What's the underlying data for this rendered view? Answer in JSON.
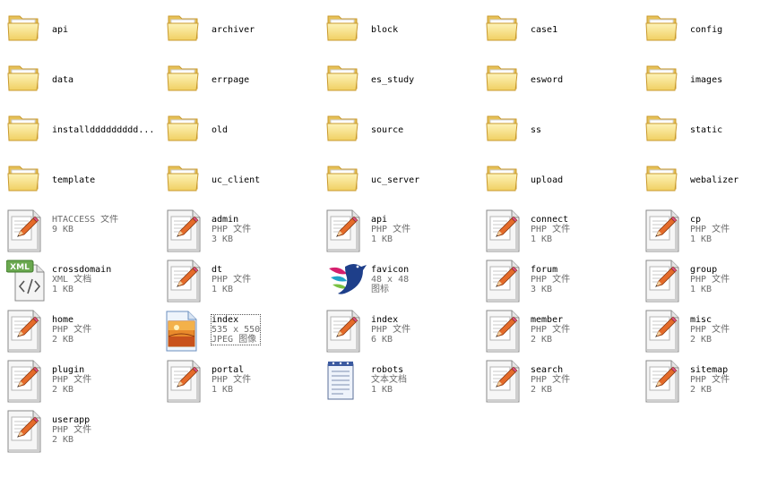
{
  "folders": [
    {
      "name": "api"
    },
    {
      "name": "archiver"
    },
    {
      "name": "block"
    },
    {
      "name": "case1"
    },
    {
      "name": "config"
    },
    {
      "name": "data"
    },
    {
      "name": "errpage"
    },
    {
      "name": "es_study"
    },
    {
      "name": "esword"
    },
    {
      "name": "images"
    },
    {
      "name": "installddddddddd..."
    },
    {
      "name": "old"
    },
    {
      "name": "source"
    },
    {
      "name": "ss"
    },
    {
      "name": "static"
    },
    {
      "name": "template"
    },
    {
      "name": "uc_client"
    },
    {
      "name": "uc_server"
    },
    {
      "name": "upload"
    },
    {
      "name": "webalizer"
    }
  ],
  "files": [
    {
      "name": "",
      "type": "HTACCESS 文件",
      "size": "9 KB",
      "icon": "text-file-pencil-icon"
    },
    {
      "name": "admin",
      "type": "PHP 文件",
      "size": "3 KB",
      "icon": "php-file-icon"
    },
    {
      "name": "api",
      "type": "PHP 文件",
      "size": "1 KB",
      "icon": "php-file-icon"
    },
    {
      "name": "connect",
      "type": "PHP 文件",
      "size": "1 KB",
      "icon": "php-file-icon"
    },
    {
      "name": "cp",
      "type": "PHP 文件",
      "size": "1 KB",
      "icon": "php-file-icon"
    },
    {
      "name": "crossdomain",
      "type": "XML 文档",
      "size": "1 KB",
      "icon": "xml-file-icon"
    },
    {
      "name": "dt",
      "type": "PHP 文件",
      "size": "1 KB",
      "icon": "php-file-icon"
    },
    {
      "name": "favicon",
      "type": "48 x 48",
      "size": "图标",
      "icon": "bird-logo-icon"
    },
    {
      "name": "forum",
      "type": "PHP 文件",
      "size": "3 KB",
      "icon": "php-file-icon"
    },
    {
      "name": "group",
      "type": "PHP 文件",
      "size": "1 KB",
      "icon": "php-file-icon"
    },
    {
      "name": "home",
      "type": "PHP 文件",
      "size": "2 KB",
      "icon": "php-file-icon"
    },
    {
      "name": "index",
      "type": "535 x 550",
      "size": "JPEG 图像",
      "icon": "jpeg-image-icon",
      "selected": true
    },
    {
      "name": "index",
      "type": "PHP 文件",
      "size": "6 KB",
      "icon": "php-file-icon"
    },
    {
      "name": "member",
      "type": "PHP 文件",
      "size": "2 KB",
      "icon": "php-file-icon"
    },
    {
      "name": "misc",
      "type": "PHP 文件",
      "size": "2 KB",
      "icon": "php-file-icon"
    },
    {
      "name": "plugin",
      "type": "PHP 文件",
      "size": "2 KB",
      "icon": "php-file-icon"
    },
    {
      "name": "portal",
      "type": "PHP 文件",
      "size": "1 KB",
      "icon": "php-file-icon"
    },
    {
      "name": "robots",
      "type": "文本文档",
      "size": "1 KB",
      "icon": "notepad-icon"
    },
    {
      "name": "search",
      "type": "PHP 文件",
      "size": "2 KB",
      "icon": "php-file-icon"
    },
    {
      "name": "sitemap",
      "type": "PHP 文件",
      "size": "2 KB",
      "icon": "php-file-icon"
    },
    {
      "name": "userapp",
      "type": "PHP 文件",
      "size": "2 KB",
      "icon": "php-file-icon"
    }
  ]
}
